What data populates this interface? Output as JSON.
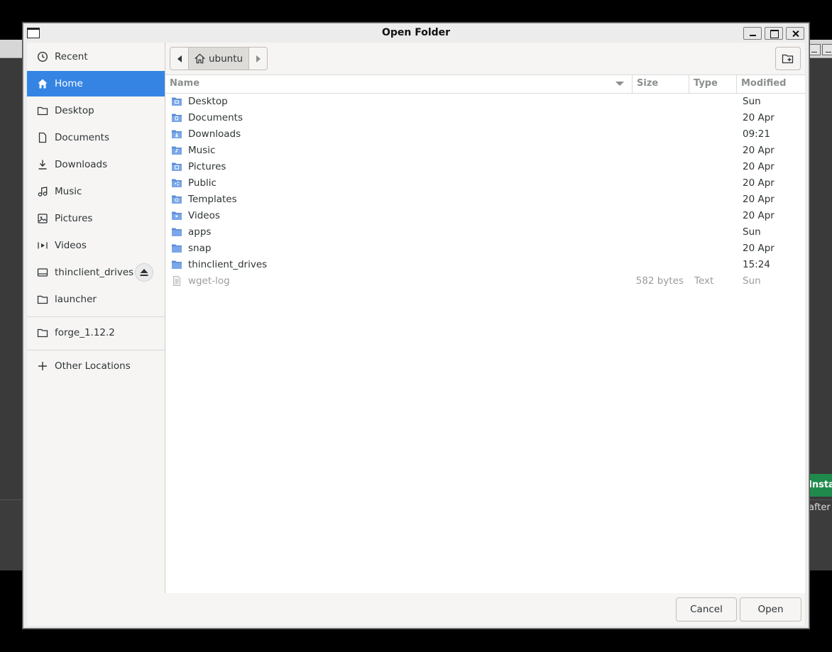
{
  "background_app": {
    "install_label": "Insta",
    "after_text": "after In"
  },
  "dialog": {
    "title": "Open Folder"
  },
  "sidebar": {
    "items": [
      {
        "label": "Recent",
        "icon": "clock-icon"
      },
      {
        "label": "Home",
        "icon": "home-icon",
        "active": true
      },
      {
        "label": "Desktop",
        "icon": "folder-icon"
      },
      {
        "label": "Documents",
        "icon": "document-icon"
      },
      {
        "label": "Downloads",
        "icon": "download-icon"
      },
      {
        "label": "Music",
        "icon": "music-icon"
      },
      {
        "label": "Pictures",
        "icon": "image-icon"
      },
      {
        "label": "Videos",
        "icon": "video-icon"
      },
      {
        "label": "thinclient_drives",
        "icon": "drive-icon"
      },
      {
        "label": "launcher",
        "icon": "folder-icon"
      }
    ],
    "bookmarks": [
      {
        "label": "forge_1.12.2",
        "icon": "folder-icon"
      }
    ],
    "other_locations": {
      "label": "Other Locations",
      "icon": "plus-icon"
    }
  },
  "pathbar": {
    "current": "ubuntu"
  },
  "columns": {
    "name": "Name",
    "size": "Size",
    "type": "Type",
    "modified": "Modified"
  },
  "files": [
    {
      "name": "Desktop",
      "size": "",
      "type": "",
      "modified": "Sun",
      "kind": "folder-desktop"
    },
    {
      "name": "Documents",
      "size": "",
      "type": "",
      "modified": "20 Apr",
      "kind": "folder-documents"
    },
    {
      "name": "Downloads",
      "size": "",
      "type": "",
      "modified": "09:21",
      "kind": "folder-downloads"
    },
    {
      "name": "Music",
      "size": "",
      "type": "",
      "modified": "20 Apr",
      "kind": "folder-music"
    },
    {
      "name": "Pictures",
      "size": "",
      "type": "",
      "modified": "20 Apr",
      "kind": "folder-pictures"
    },
    {
      "name": "Public",
      "size": "",
      "type": "",
      "modified": "20 Apr",
      "kind": "folder-public"
    },
    {
      "name": "Templates",
      "size": "",
      "type": "",
      "modified": "20 Apr",
      "kind": "folder-templates"
    },
    {
      "name": "Videos",
      "size": "",
      "type": "",
      "modified": "20 Apr",
      "kind": "folder-videos"
    },
    {
      "name": "apps",
      "size": "",
      "type": "",
      "modified": "Sun",
      "kind": "folder"
    },
    {
      "name": "snap",
      "size": "",
      "type": "",
      "modified": "20 Apr",
      "kind": "folder"
    },
    {
      "name": "thinclient_drives",
      "size": "",
      "type": "",
      "modified": "15:24",
      "kind": "folder"
    },
    {
      "name": "wget-log",
      "size": "582 bytes",
      "type": "Text",
      "modified": "Sun",
      "kind": "text-file"
    }
  ],
  "actions": {
    "cancel": "Cancel",
    "open": "Open"
  },
  "colors": {
    "accent": "#3584e4",
    "folder": "#5b8ed6",
    "sidebar_bg": "#f6f5f4"
  }
}
